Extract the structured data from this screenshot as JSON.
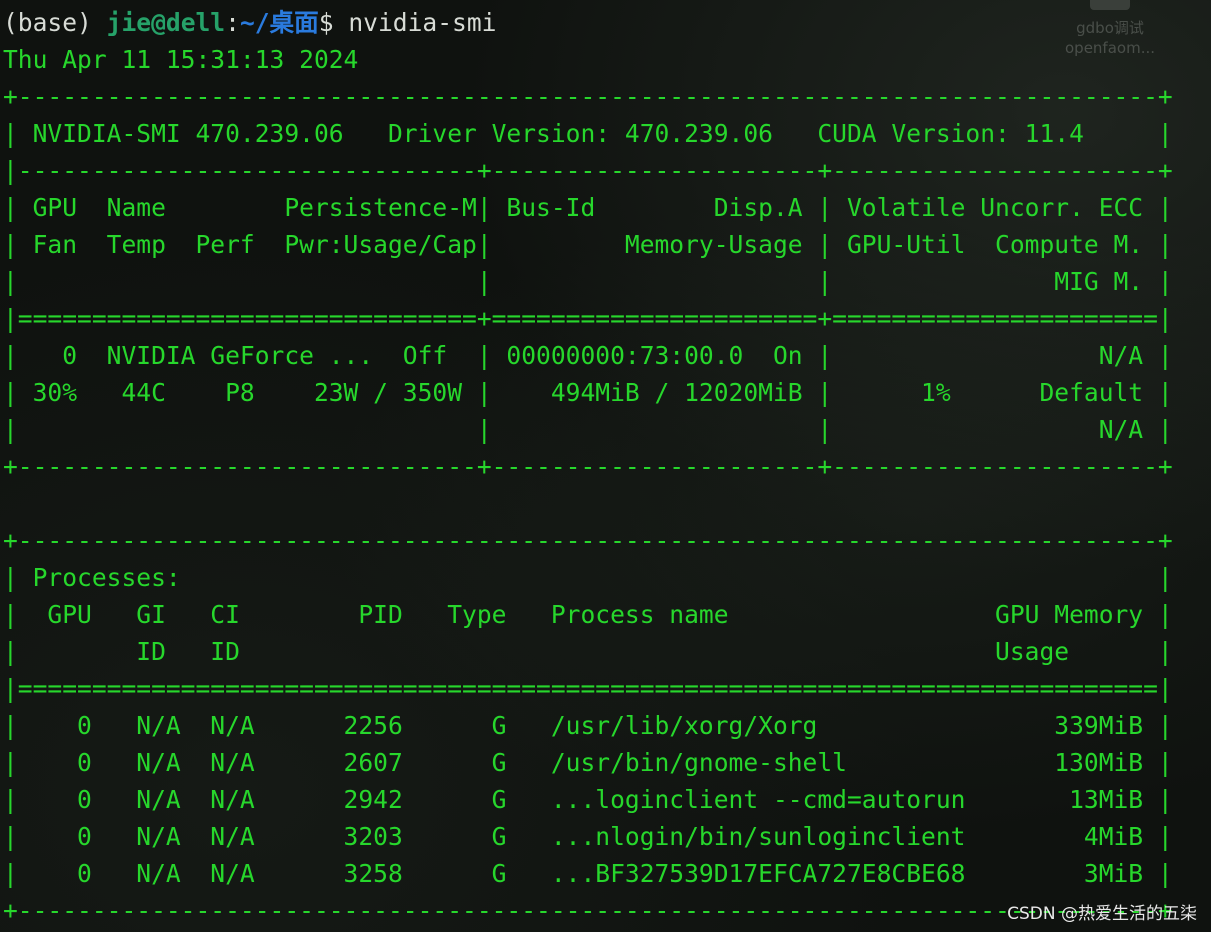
{
  "desktop": {
    "icon_label_1": "gdbo调试",
    "icon_label_2": "openfaom..."
  },
  "prompt": {
    "env": "(base) ",
    "user_host": "jie@dell",
    "separator": ":",
    "path": "~/桌面",
    "dollar": "$ ",
    "command": "nvidia-smi"
  },
  "timestamp": "Thu Apr 11 15:31:13 2024",
  "smi_header": {
    "border_top": "+-----------------------------------------------------------------------------+",
    "version_line": "| NVIDIA-SMI 470.239.06   Driver Version: 470.239.06   CUDA Version: 11.4     |",
    "divider": "|-------------------------------+----------------------+----------------------+",
    "columns_1": "| GPU  Name        Persistence-M| Bus-Id        Disp.A | Volatile Uncorr. ECC |",
    "columns_2": "| Fan  Temp  Perf  Pwr:Usage/Cap|         Memory-Usage | GPU-Util  Compute M. |",
    "columns_3": "|                               |                      |               MIG M. |",
    "double_divider": "|===============================+======================+======================|"
  },
  "gpu_rows": [
    "|   0  NVIDIA GeForce ...  Off  | 00000000:73:00.0  On |                  N/A |",
    "| 30%   44C    P8    23W / 350W |    494MiB / 12020MiB |      1%      Default |",
    "|                               |                      |                  N/A |"
  ],
  "gpu_border_bottom": "+-------------------------------+----------------------+----------------------+",
  "blank_line": " ",
  "processes": {
    "border_top": "+-----------------------------------------------------------------------------+",
    "title": "| Processes:                                                                  |",
    "header_1": "|  GPU   GI   CI        PID   Type   Process name                  GPU Memory |",
    "header_2": "|        ID   ID                                                   Usage      |",
    "double_divider": "|=============================================================================|",
    "rows": [
      "|    0   N/A  N/A      2256      G   /usr/lib/xorg/Xorg                339MiB |",
      "|    0   N/A  N/A      2607      G   /usr/bin/gnome-shell              130MiB |",
      "|    0   N/A  N/A      2942      G   ...loginclient --cmd=autorun       13MiB |",
      "|    0   N/A  N/A      3203      G   ...nlogin/bin/sunloginclient        4MiB |",
      "|    0   N/A  N/A      3258      G   ...BF327539D17EFCA727E8CBE68        3MiB |"
    ],
    "border_bottom": "+-----------------------------------------------------------------------------+"
  },
  "watermark": "CSDN @热爱生活的五柒"
}
